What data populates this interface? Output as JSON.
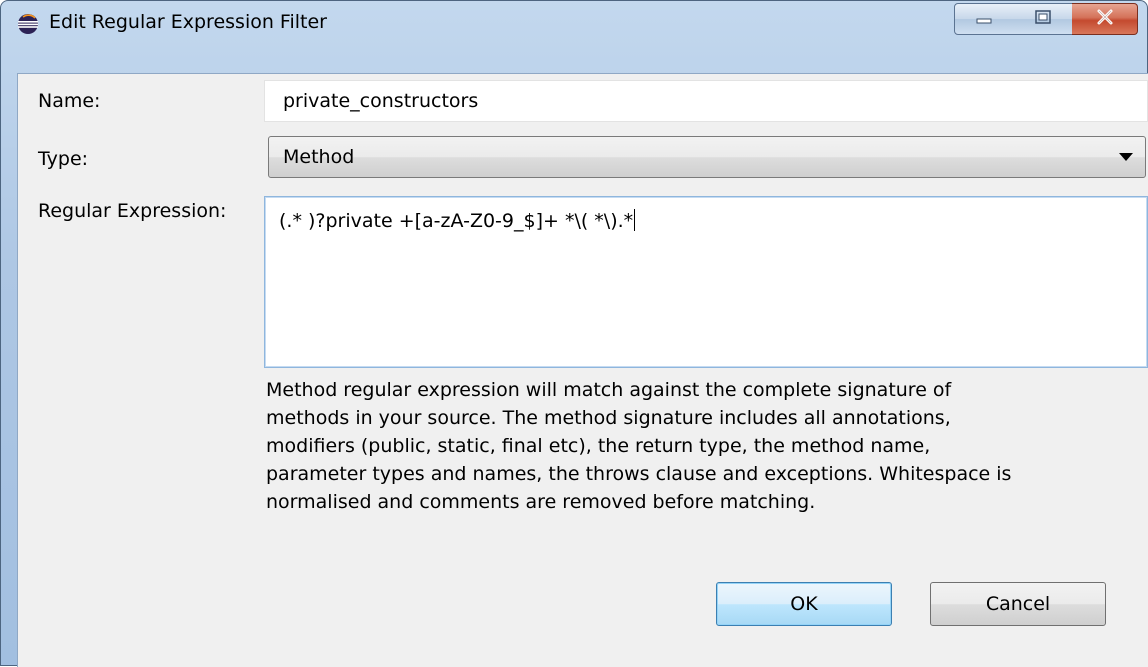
{
  "window": {
    "title": "Edit Regular Expression Filter"
  },
  "form": {
    "name_label": "Name:",
    "name_value": "private_constructors",
    "type_label": "Type:",
    "type_value": "Method",
    "regex_label": "Regular Expression:",
    "regex_value": "(.* )?private +[a-zA-Z0-9_$]+ *\\( *\\).*"
  },
  "help": {
    "lines": [
      "Method regular expression will match against the complete signature of",
      "methods in your source. The method signature includes all annotations,",
      "modifiers (public, static, final etc), the return type, the method name,",
      "parameter types and names, the throws clause and exceptions. Whitespace is",
      "normalised and comments are removed before matching."
    ]
  },
  "buttons": {
    "ok": "OK",
    "cancel": "Cancel"
  },
  "colors": {
    "titlebar": "#aec7e4",
    "dialog_background": "#f0f0f0",
    "close_button": "#c44a2f",
    "ok_button_border": "#3c7fb1"
  },
  "icons": {
    "app": "eclipse-icon",
    "minimize": "minimize-icon",
    "maximize": "maximize-icon",
    "close": "close-icon",
    "dropdown": "chevron-down-icon"
  }
}
